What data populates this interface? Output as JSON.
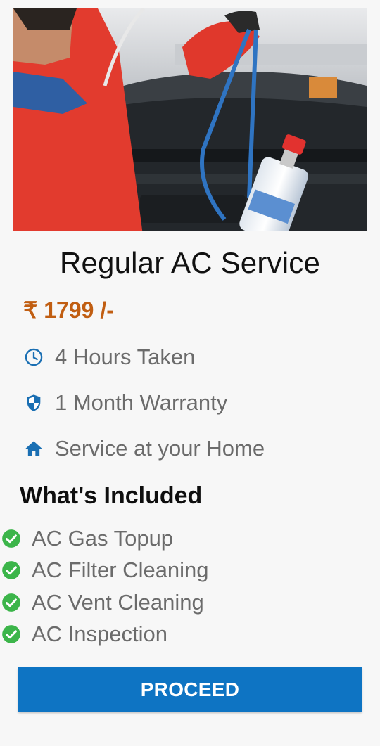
{
  "service": {
    "title": "Regular AC Service",
    "price": "₹ 1799 /-"
  },
  "features": [
    {
      "icon": "clock-icon",
      "label": "4 Hours Taken"
    },
    {
      "icon": "shield-icon",
      "label": "1 Month Warranty"
    },
    {
      "icon": "home-icon",
      "label": "Service at your Home"
    }
  ],
  "included": {
    "heading": "What's Included",
    "items": [
      "AC Gas Topup",
      "AC Filter Cleaning",
      "AC Vent Cleaning",
      "AC Inspection"
    ]
  },
  "actions": {
    "proceed_label": "PROCEED"
  },
  "colors": {
    "price": "#c15e12",
    "accent_blue": "#0e74c3",
    "icon_blue": "#1a6fb3",
    "check_green": "#3cb54a"
  }
}
